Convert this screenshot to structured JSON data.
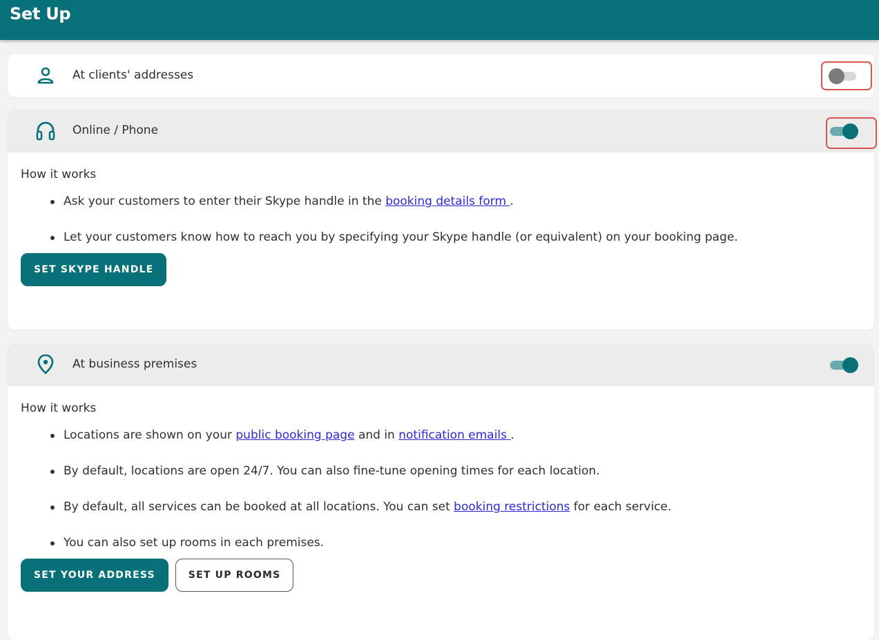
{
  "header": {
    "title": "Set Up"
  },
  "colors": {
    "brand": "#077078",
    "link": "#2a2ad6",
    "highlight": "#d9534f",
    "toggle_off": "#7c7c7c"
  },
  "sections": {
    "clients": {
      "label": "At clients' addresses",
      "icon": "person-icon",
      "enabled": false
    },
    "online": {
      "label": "Online / Phone",
      "icon": "headset-icon",
      "enabled": true,
      "how_title": "How it works",
      "bullet1_pre": "Ask your customers to enter their Skype handle in the ",
      "bullet1_link": "booking details form ",
      "bullet1_post": ".",
      "bullet2": "Let your customers know how to reach you by specifying your Skype handle (or equivalent) on your booking page.",
      "button": "SET SKYPE HANDLE"
    },
    "business": {
      "label": "At business premises",
      "icon": "location-pin-icon",
      "enabled": true,
      "how_title": "How it works",
      "bullet1_pre": "Locations are shown on your ",
      "bullet1_link1": "public booking page",
      "bullet1_mid": " and in ",
      "bullet1_link2": "notification emails ",
      "bullet1_post": ".",
      "bullet2": "By default, locations are open 24/7. You can also fine-tune opening times for each location.",
      "bullet3_pre": "By default, all services can be booked at all locations. You can set ",
      "bullet3_link": "booking restrictions",
      "bullet3_post": " for each service.",
      "bullet4": "You can also set up rooms in each premises.",
      "button_primary": "SET YOUR ADDRESS",
      "button_secondary": "SET UP ROOMS"
    }
  }
}
